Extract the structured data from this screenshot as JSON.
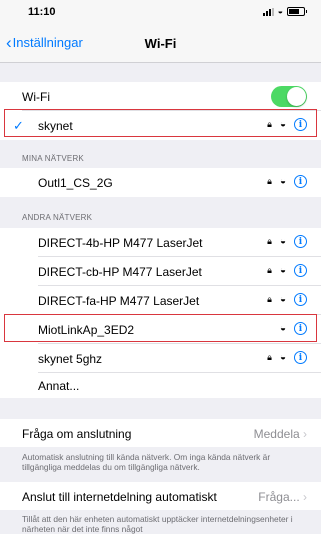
{
  "status_bar": {
    "time": "11:10"
  },
  "nav": {
    "back_label": "Inställningar",
    "title": "Wi-Fi"
  },
  "wifi_toggle": {
    "label": "Wi-Fi",
    "on": true
  },
  "connected_network": {
    "name": "skynet"
  },
  "my_networks": {
    "header": "MINA NÄTVERK",
    "items": [
      {
        "name": "Outl1_CS_2G"
      }
    ]
  },
  "other_networks": {
    "header": "ANDRA NÄTVERK",
    "items": [
      {
        "name": "DIRECT-4b-HP M477 LaserJet"
      },
      {
        "name": "DIRECT-cb-HP M477 LaserJet"
      },
      {
        "name": "DIRECT-fa-HP M477 LaserJet"
      },
      {
        "name": "MiotLinkAp_3ED2"
      },
      {
        "name": "skynet 5ghz"
      },
      {
        "name": "Annat..."
      }
    ]
  },
  "ask_to_join": {
    "label": "Fråga om anslutning",
    "value": "Meddela",
    "footer": "Automatisk anslutning till kända nätverk. Om inga kända nätverk är tillgängliga meddelas du om tillgängliga nätverk."
  },
  "auto_hotspot": {
    "label": "Anslut till internetdelning automatiskt",
    "value": "Fråga...",
    "footer": "Tillåt att den här enheten automatiskt upptäcker internetdelningsenheter i närheten när det inte finns något"
  }
}
